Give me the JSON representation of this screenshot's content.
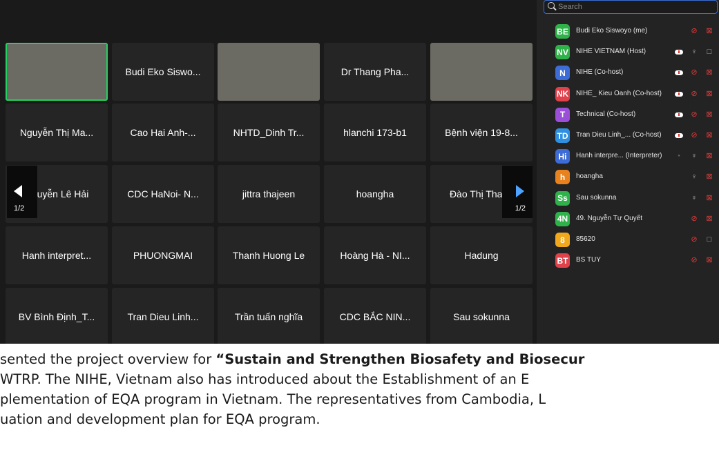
{
  "search": {
    "placeholder": "Search"
  },
  "gallery": {
    "tiles": [
      [
        "",
        "Budi Eko Siswo...",
        "",
        "Dr Thang Pha...",
        ""
      ],
      [
        "Nguyễn Thị Ma...",
        "Cao Hai Anh-...",
        "NHTD_Dinh Tr...",
        "hlanchi 173-b1",
        "Bệnh viện 19-8..."
      ],
      [
        "Nguyễn Lê Hải",
        "CDC HaNoi- N...",
        "jittra thajeen",
        "hoangha",
        "Đào Thị Thanh"
      ],
      [
        "Hanh interpret...",
        "PHUONGMAI",
        "Thanh Huong Le",
        "Hoàng Hà - NI...",
        "Hadung"
      ],
      [
        "BV Bình Định_T...",
        "Tran Dieu Linh...",
        "Trần tuấn nghĩa",
        "CDC BẮC NIN...",
        "Sau sokunna"
      ]
    ],
    "page_left": "1/2",
    "page_right": "1/2"
  },
  "participants": [
    {
      "initials": "BE",
      "name": "Budi Eko Siswoyo (me)",
      "color": "#2fb24a",
      "badge": "",
      "mic": "muted",
      "cam": "muted"
    },
    {
      "initials": "NV",
      "name": "NIHE VIETNAM (Host)",
      "color": "#2fb24a",
      "badge": "cloud",
      "mic": "on",
      "cam": "on"
    },
    {
      "initials": "N",
      "name": "NIHE (Co-host)",
      "color": "#3d6cd6",
      "badge": "cloud",
      "mic": "muted",
      "cam": "muted"
    },
    {
      "initials": "NK",
      "name": "NIHE_ Kieu Oanh (Co-host)",
      "color": "#e0424b",
      "badge": "cloud",
      "mic": "muted",
      "cam": "muted"
    },
    {
      "initials": "T",
      "name": "Technical (Co-host)",
      "color": "#9b4fd8",
      "badge": "cloud",
      "mic": "muted",
      "cam": "muted"
    },
    {
      "initials": "TD",
      "name": "Tran Dieu Linh_... (Co-host)",
      "color": "#2f8fe0",
      "badge": "cloud",
      "mic": "muted",
      "cam": "muted"
    },
    {
      "initials": "Hi",
      "name": "Hanh interpre... (Interpreter)",
      "color": "#3d6cd6",
      "badge": "lang",
      "mic": "on",
      "cam": "muted"
    },
    {
      "initials": "h",
      "name": "hoangha",
      "color": "#e8821e",
      "badge": "",
      "mic": "on",
      "cam": "muted"
    },
    {
      "initials": "Ss",
      "name": "Sau sokunna",
      "color": "#2fb24a",
      "badge": "",
      "mic": "on",
      "cam": "muted"
    },
    {
      "initials": "4N",
      "name": "49. Nguyễn Tự Quyết",
      "color": "#2fb24a",
      "badge": "",
      "mic": "muted",
      "cam": "muted"
    },
    {
      "initials": "8",
      "name": "85620",
      "color": "#f2a81c",
      "badge": "",
      "mic": "muted",
      "cam": "on"
    },
    {
      "initials": "BT",
      "name": "BS TUY",
      "color": "#e0424b",
      "badge": "",
      "mic": "muted",
      "cam": "muted"
    }
  ],
  "document": {
    "line1_pre": "sented the project overview for ",
    "line1_bold": "“Sustain and Strengthen Biosafety and Biosecur",
    "line2": "WTRP. The NIHE, Vietnam also has introduced about the Establishment of an E",
    "line3": "plementation of EQA program in Vietnam. The representatives from Cambodia, L",
    "line4": "uation and development plan for EQA program."
  }
}
